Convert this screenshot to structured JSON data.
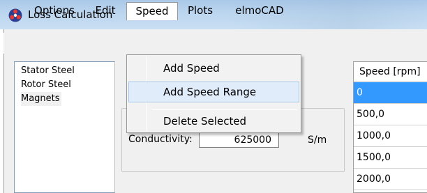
{
  "window": {
    "title": "Loss Calculation",
    "icon": "app-logo-icon"
  },
  "menubar": {
    "items": [
      {
        "label": "Options"
      },
      {
        "label": "Edit"
      },
      {
        "label": "Speed"
      },
      {
        "label": "Plots"
      },
      {
        "label": "elmoCAD"
      }
    ],
    "open_menu": "Speed"
  },
  "material_list": {
    "items": [
      "Stator Steel",
      "Rotor Steel",
      "Magnets"
    ],
    "selected": "Magnets"
  },
  "properties": {
    "conductivity_label": "Conductivity:",
    "conductivity_value": "625000",
    "conductivity_unit": "S/m"
  },
  "speed_grid": {
    "header": "Speed [rpm]",
    "rows": [
      "0",
      "500,0",
      "1000,0",
      "1500,0",
      "2000,0"
    ],
    "selected_row": "0"
  },
  "speed_menu": {
    "items": [
      {
        "label": "Add Speed"
      },
      {
        "label": "Add Speed Range"
      },
      {
        "label": "Delete Selected"
      }
    ],
    "highlighted": "Add Speed Range"
  },
  "colors": {
    "selection": "#3399ff",
    "menu_highlight": "#e1ecfb",
    "titlebar": "#bcd6ef"
  }
}
